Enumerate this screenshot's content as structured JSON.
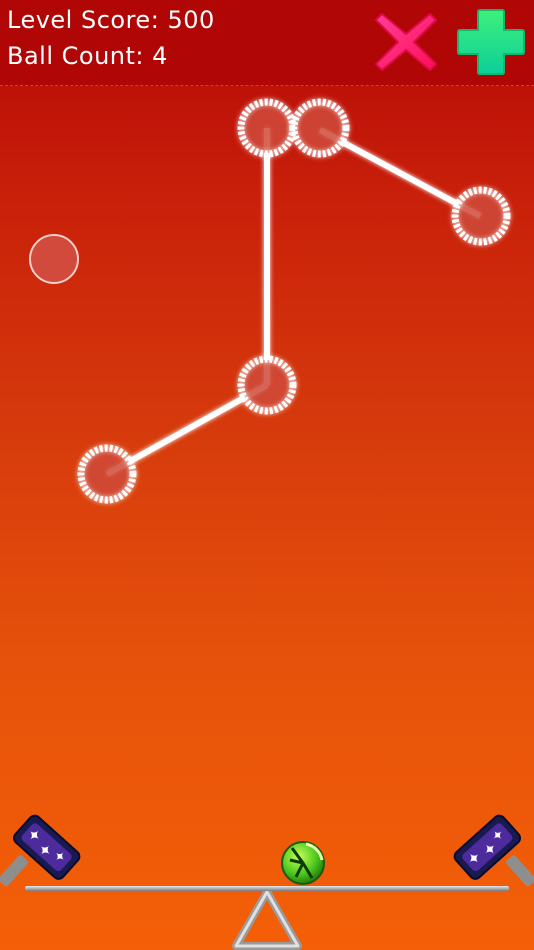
{
  "hud": {
    "score_label": "Level Score:",
    "score_value": "500",
    "ball_label": "Ball Count:",
    "ball_value": "4",
    "close_icon": "pink-x-icon",
    "add_icon": "green-plus-icon"
  },
  "colors": {
    "background_top": "#b40606",
    "background_bottom": "#f45f07",
    "close_button": "#ff1f7a",
    "add_button": "#22dd7a",
    "node_fill": "#cf4a3a",
    "rope": "#ffffff"
  },
  "scene": {
    "free_ball": "loose-ball",
    "rope_nodes": 6,
    "center_ball_icon": "green-speed-ball-icon",
    "left_launcher_icon": "hammer-launcher-icon",
    "right_launcher_icon": "hammer-launcher-icon"
  }
}
